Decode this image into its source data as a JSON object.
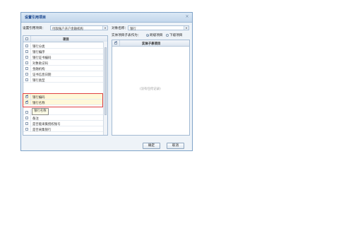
{
  "dialog": {
    "title": "设置引用项目",
    "close_glyph": "×"
  },
  "left": {
    "source_label": "设置引用项目：",
    "source_value": "付款账户开户金融机构",
    "column_header": "项目",
    "rows": [
      {
        "label": "银行分类",
        "checked": false
      },
      {
        "label": "银行编序",
        "checked": false
      },
      {
        "label": "银行证书编码",
        "checked": false
      },
      {
        "label": "对象助记码",
        "checked": false
      },
      {
        "label": "金融机构",
        "checked": false
      },
      {
        "label": "证书信息日期",
        "checked": false
      },
      {
        "label": "银行类型",
        "checked": false
      },
      {
        "label": "银行编码",
        "checked": true
      },
      {
        "label": "银行名称",
        "checked": true
      },
      {
        "label": "",
        "checked": false
      },
      {
        "label": "备注",
        "checked": false
      },
      {
        "label": "是否能采集授权账号",
        "checked": false
      },
      {
        "label": "是否采集银行",
        "checked": false
      }
    ],
    "tooltip": "银行名称"
  },
  "right": {
    "object_label": "对象名称：",
    "object_value": "银行",
    "entity_label": "实体项目子表作为：",
    "radio_options": [
      {
        "label": "跨级项目",
        "selected": true
      },
      {
        "label": "下级项目",
        "selected": false
      }
    ],
    "column_header": "实体子表项目",
    "empty_text": "(没有任何记录)"
  },
  "buttons": {
    "ok": "确定",
    "cancel": "取消"
  }
}
